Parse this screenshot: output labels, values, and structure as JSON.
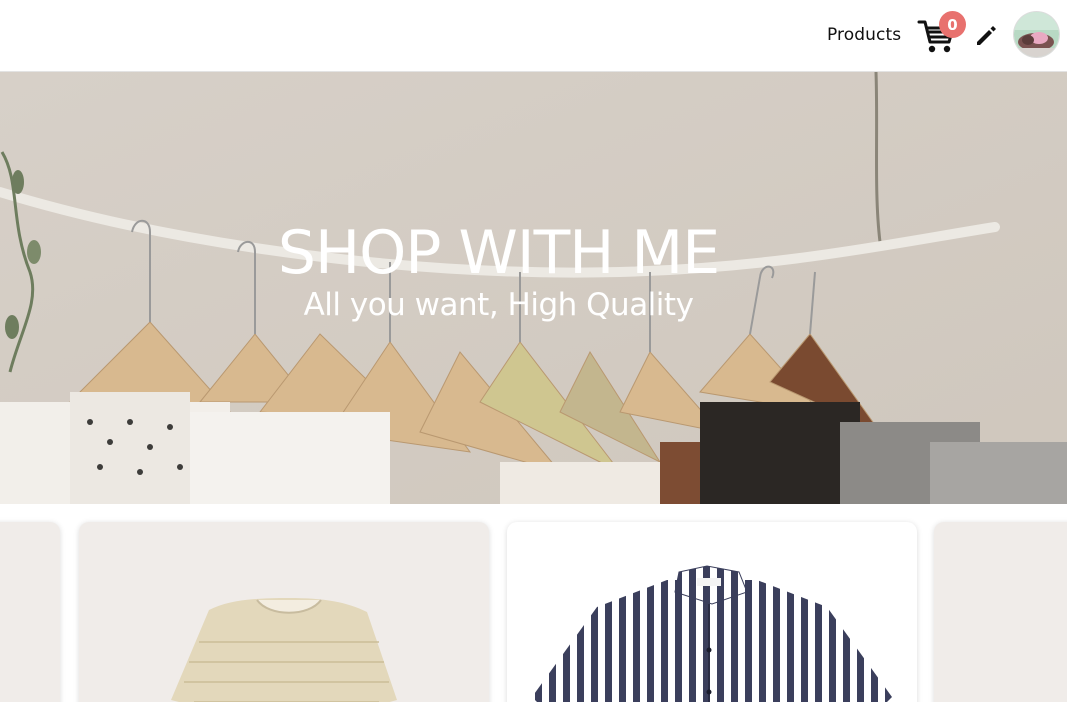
{
  "nav": {
    "products_label": "Products",
    "cart_count": "0",
    "icons": {
      "cart": "cart-icon",
      "edit": "pencil-icon",
      "avatar": "user-avatar"
    }
  },
  "hero": {
    "title": "SHOP WITH ME",
    "subtitle": "All you want, High Quality"
  },
  "products": [
    {
      "image": "product-partial-left"
    },
    {
      "image": "tweed-dress"
    },
    {
      "image": "striped-shirt"
    },
    {
      "image": "product-partial-right"
    }
  ],
  "colors": {
    "badge": "#e8716e",
    "card_bg": "#f0ece9",
    "text": "#111111"
  }
}
